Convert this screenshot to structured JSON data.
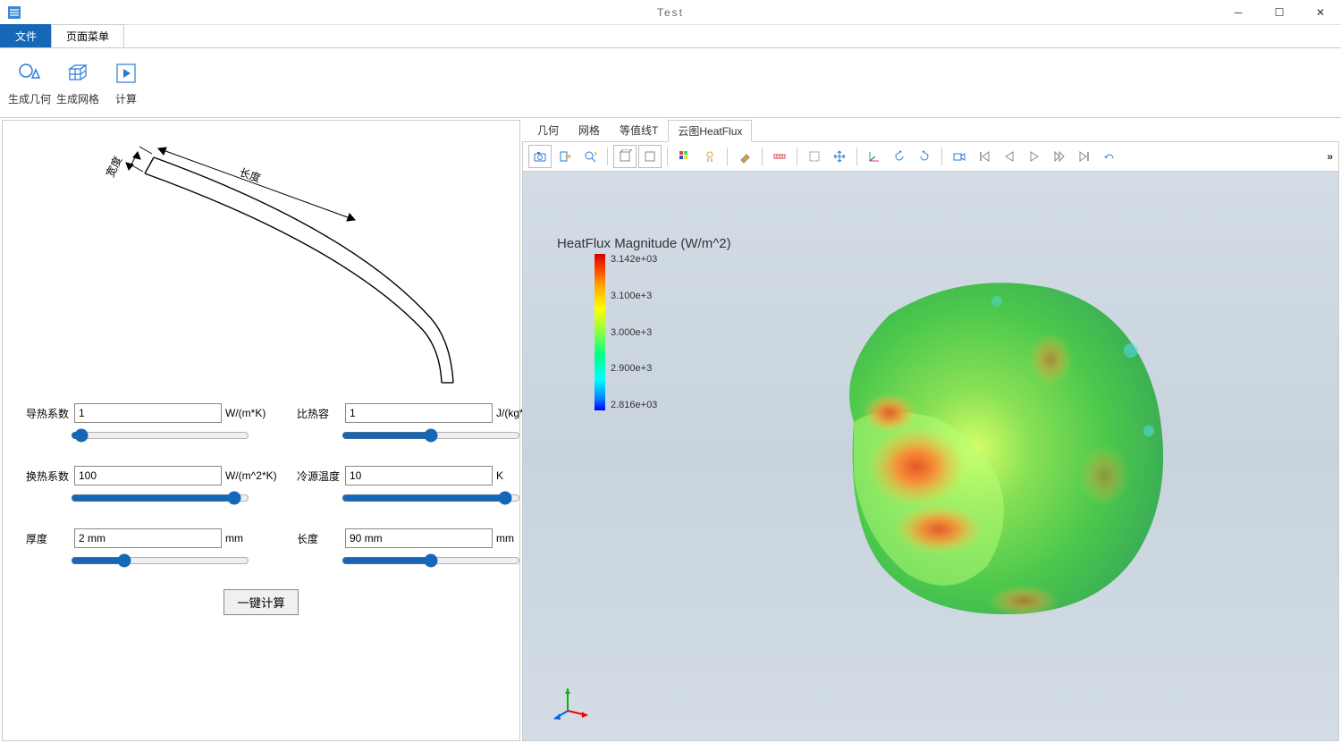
{
  "titlebar": {
    "title": "Test"
  },
  "menutabs": [
    {
      "label": "文件",
      "active": true
    },
    {
      "label": "页面菜单",
      "active": false
    }
  ],
  "ribbon": [
    {
      "label": "生成几何",
      "name": "generate-geometry-button"
    },
    {
      "label": "生成网格",
      "name": "generate-mesh-button"
    },
    {
      "label": "计算",
      "name": "calculate-button"
    }
  ],
  "diagram": {
    "length_label": "长度",
    "width_label": "宽度"
  },
  "params": {
    "thermal_conductivity": {
      "label": "导热系数",
      "value": "1",
      "unit": "W/(m*K)"
    },
    "specific_heat": {
      "label": "比热容",
      "value": "1",
      "unit": "J/(kg*K)"
    },
    "heat_transfer": {
      "label": "换热系数",
      "value": "100",
      "unit": "W/(m^2*K)"
    },
    "cold_source_temp": {
      "label": "冷源温度",
      "value": "10",
      "unit": "K"
    },
    "thickness": {
      "label": "厚度",
      "value": "2 mm",
      "unit": "mm"
    },
    "length": {
      "label": "长度",
      "value": "90 mm",
      "unit": "mm"
    }
  },
  "calc_button": "一键计算",
  "viz_tabs": [
    {
      "label": "几何",
      "active": false
    },
    {
      "label": "网格",
      "active": false
    },
    {
      "label": "等值线T",
      "active": false
    },
    {
      "label": "云图HeatFlux",
      "active": true
    }
  ],
  "viz_title": "HeatFlux Magnitude (W/m^2)",
  "colorbar": {
    "ticks": [
      "3.142e+03",
      "3.100e+3",
      "3.000e+3",
      "2.900e+3",
      "2.816e+03"
    ]
  }
}
